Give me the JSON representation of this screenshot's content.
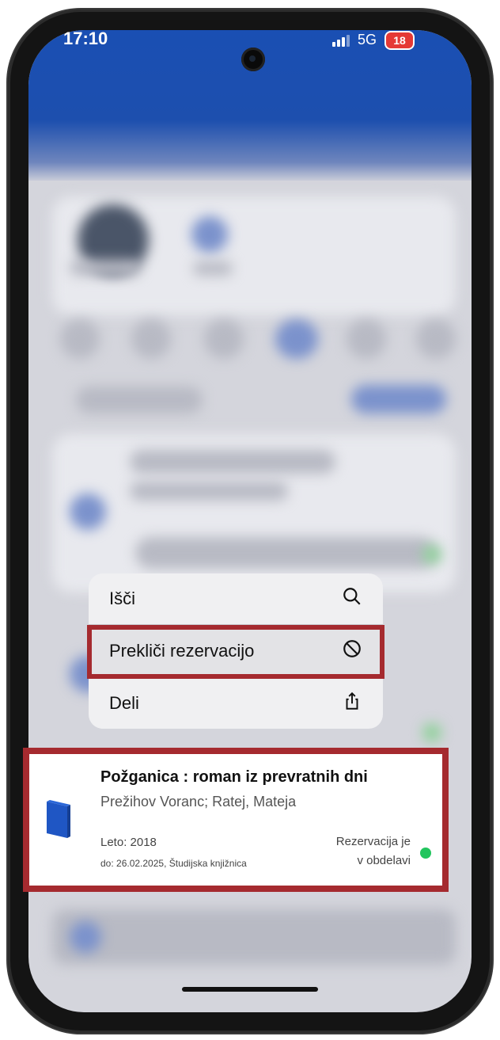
{
  "status_bar": {
    "time": "17:10",
    "network": "5G",
    "battery": "18"
  },
  "context_menu": {
    "items": [
      {
        "label": "Išči",
        "icon": "search-icon"
      },
      {
        "label": "Prekliči rezervacijo",
        "icon": "cancel-circle-icon"
      },
      {
        "label": "Deli",
        "icon": "share-icon"
      }
    ],
    "highlighted_index": 1
  },
  "reservation_card": {
    "title": "Požganica : roman iz prevratnih dni",
    "author": "Prežihov Voranc; Ratej, Mateja",
    "year": "Leto: 2018",
    "due": "do: 26.02.2025, Študijska knjižnica",
    "status_line1": "Rezervacija je",
    "status_line2": "v obdelavi",
    "icon": "book-icon"
  },
  "colors": {
    "header_blue": "#1d4fae",
    "highlight_red": "#a52a2f",
    "status_green": "#22c55e",
    "book_blue": "#1f56c4"
  }
}
